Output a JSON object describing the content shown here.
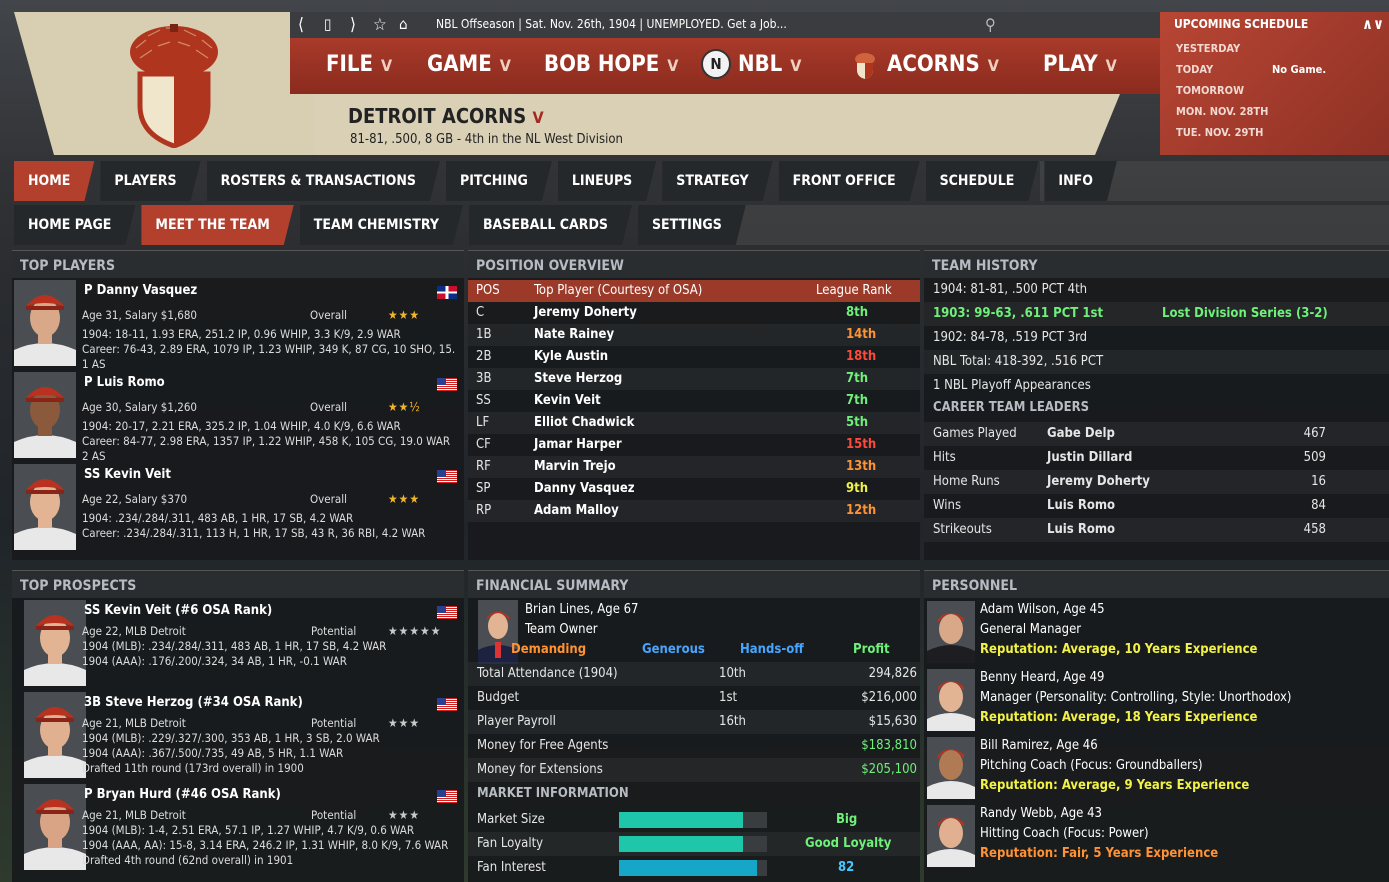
{
  "topbar": {
    "status": "NBL Offseason  |  Sat. Nov. 26th, 1904  |  UNEMPLOYED. Get a Job..."
  },
  "menu": {
    "file": "FILE",
    "game": "GAME",
    "user": "BOB HOPE",
    "league": "NBL",
    "team": "ACORNS",
    "play": "PLAY",
    "league_badge": "N"
  },
  "team": {
    "name": "DETROIT ACORNS",
    "record": "81-81, .500, 8 GB - 4th in the NL West Division"
  },
  "schedule": {
    "title": "UPCOMING SCHEDULE",
    "days": [
      "YESTERDAY",
      "TODAY",
      "TOMORROW",
      "MON. NOV. 28TH",
      "TUE. NOV. 29TH"
    ],
    "today_game": "No Game."
  },
  "nav_main": [
    "HOME",
    "PLAYERS",
    "ROSTERS & TRANSACTIONS",
    "PITCHING",
    "LINEUPS",
    "STRATEGY",
    "FRONT OFFICE",
    "SCHEDULE",
    "INFO"
  ],
  "nav_sub": [
    "HOME PAGE",
    "MEET THE TEAM",
    "TEAM CHEMISTRY",
    "BASEBALL CARDS",
    "SETTINGS"
  ],
  "top_players": {
    "title": "TOP PLAYERS",
    "overall_label": "Overall",
    "players": [
      {
        "name": "P Danny Vasquez",
        "info": "Age 31, Salary $1,680",
        "stars": "★★★",
        "line1": "1904: 18-11, 1.93 ERA, 251.2 IP, 0.96 WHIP, 3.3 K/9, 2.9 WAR",
        "line2": "Career: 76-43, 2.89 ERA, 1079 IP, 1.23 WHIP, 349 K, 87 CG, 10 SHO, 15.",
        "line3": "1 AS"
      },
      {
        "name": "P Luis Romo",
        "info": "Age 30, Salary $1,260",
        "stars": "★★½",
        "line1": "1904: 20-17, 2.21 ERA, 325.2 IP, 1.04 WHIP, 4.0 K/9, 6.6 WAR",
        "line2": "Career: 84-77, 2.98 ERA, 1357 IP, 1.22 WHIP, 458 K, 105 CG, 19.0 WAR",
        "line3": "2 AS"
      },
      {
        "name": "SS Kevin Veit",
        "info": "Age 22, Salary $370",
        "stars": "★★★",
        "line1": "1904: .234/.284/.311, 483 AB, 1 HR, 17 SB, 4.2 WAR",
        "line2": "Career: .234/.284/.311, 113 H, 1 HR, 17 SB, 43 R, 36 RBI, 4.2 WAR",
        "line3": ""
      }
    ]
  },
  "position_overview": {
    "title": "POSITION OVERVIEW",
    "headers": [
      "POS",
      "Top Player (Courtesy of OSA)",
      "League Rank"
    ],
    "rows": [
      {
        "pos": "C",
        "player": "Jeremy Doherty",
        "rank": "8th",
        "color": "#6ef07a"
      },
      {
        "pos": "1B",
        "player": "Nate Rainey",
        "rank": "14th",
        "color": "#ff9233"
      },
      {
        "pos": "2B",
        "player": "Kyle Austin",
        "rank": "18th",
        "color": "#ff4a3a"
      },
      {
        "pos": "3B",
        "player": "Steve Herzog",
        "rank": "7th",
        "color": "#6ef07a"
      },
      {
        "pos": "SS",
        "player": "Kevin Veit",
        "rank": "7th",
        "color": "#6ef07a"
      },
      {
        "pos": "LF",
        "player": "Elliot Chadwick",
        "rank": "5th",
        "color": "#6ef07a"
      },
      {
        "pos": "CF",
        "player": "Jamar Harper",
        "rank": "15th",
        "color": "#ff4a3a"
      },
      {
        "pos": "RF",
        "player": "Marvin Trejo",
        "rank": "13th",
        "color": "#ff9233"
      },
      {
        "pos": "SP",
        "player": "Danny Vasquez",
        "rank": "9th",
        "color": "#f2f246"
      },
      {
        "pos": "RP",
        "player": "Adam Malloy",
        "rank": "12th",
        "color": "#ff9233"
      }
    ]
  },
  "team_history": {
    "title": "TEAM HISTORY",
    "rows": [
      "1904: 81-81, .500 PCT 4th",
      "1903: 99-63, .611 PCT 1st",
      "1902: 84-78, .519 PCT 3rd",
      "NBL Total: 418-392, .516 PCT",
      "1 NBL Playoff Appearances"
    ],
    "note_1903": "Lost Division Series (3-2)",
    "leaders_title": "CAREER TEAM LEADERS",
    "leaders": [
      {
        "cat": "Games Played",
        "name": "Gabe Delp",
        "val": "467"
      },
      {
        "cat": "Hits",
        "name": "Justin Dillard",
        "val": "509"
      },
      {
        "cat": "Home Runs",
        "name": "Jeremy Doherty",
        "val": "16"
      },
      {
        "cat": "Wins",
        "name": "Luis Romo",
        "val": "84"
      },
      {
        "cat": "Strikeouts",
        "name": "Luis Romo",
        "val": "458"
      }
    ]
  },
  "top_prospects": {
    "title": "TOP PROSPECTS",
    "potential_label": "Potential",
    "players": [
      {
        "name": "SS Kevin Veit (#6 OSA Rank)",
        "info": "Age 22, MLB Detroit",
        "stars": "★★★★★",
        "line1": "1904 (MLB): .234/.284/.311, 483 AB, 1 HR, 17 SB, 4.2 WAR",
        "line2": "1904 (AAA): .176/.200/.324, 34 AB, 1 HR, -0.1 WAR",
        "line3": ""
      },
      {
        "name": "3B Steve Herzog (#34 OSA Rank)",
        "info": "Age 21, MLB Detroit",
        "stars": "★★★",
        "line1": "1904 (MLB): .229/.327/.300, 353 AB, 1 HR, 3 SB, 2.0 WAR",
        "line2": "1904 (AAA): .367/.500/.735, 49 AB, 5 HR, 1.1 WAR",
        "line3": "Drafted 11th round (173rd overall) in 1900"
      },
      {
        "name": "P Bryan Hurd (#46 OSA Rank)",
        "info": "Age 21, MLB Detroit",
        "stars": "★★★",
        "line1": "1904 (MLB): 1-4, 2.51 ERA, 57.1 IP, 1.27 WHIP, 4.7 K/9, 0.6 WAR",
        "line2": "1904 (AAA, AA): 15-8, 3.14 ERA, 246.2 IP, 1.31 WHIP, 8.0 K/9, 7.6 WAR",
        "line3": "Drafted 4th round (62nd overall) in 1901"
      }
    ]
  },
  "financial": {
    "title": "FINANCIAL SUMMARY",
    "owner_name": "Brian Lines, Age 67",
    "owner_role": "Team Owner",
    "traits": [
      "Demanding",
      "Generous",
      "Hands-off",
      "Profit"
    ],
    "rows": [
      {
        "label": "Total Attendance (1904)",
        "rank": "10th",
        "value": "294,826"
      },
      {
        "label": "Budget",
        "rank": "1st",
        "value": "$216,000"
      },
      {
        "label": "Player Payroll",
        "rank": "16th",
        "value": "$15,630"
      },
      {
        "label": "Money for Free Agents",
        "rank": "",
        "value": "$183,810"
      },
      {
        "label": "Money for Extensions",
        "rank": "",
        "value": "$205,100"
      }
    ],
    "market_title": "MARKET INFORMATION",
    "market": [
      {
        "label": "Market Size",
        "value": "Big",
        "fill": 0.84,
        "color": "#1fc7aa"
      },
      {
        "label": "Fan Loyalty",
        "value": "Good Loyalty",
        "fill": 0.84,
        "color": "#1fc7aa"
      },
      {
        "label": "Fan Interest",
        "value": "82",
        "fill": 0.93,
        "color": "#16a7c8"
      }
    ]
  },
  "personnel": {
    "title": "PERSONNEL",
    "people": [
      {
        "name": "Adam Wilson, Age 45",
        "role": "General Manager",
        "rep": "Reputation: Average, 10 Years Experience",
        "rep_color": "#f2f246"
      },
      {
        "name": "Benny Heard, Age 49",
        "role": "Manager (Personality: Controlling, Style: Unorthodox)",
        "rep": "Reputation: Average, 18 Years Experience",
        "rep_color": "#f2f246"
      },
      {
        "name": "Bill Ramirez, Age 46",
        "role": "Pitching Coach (Focus: Groundballers)",
        "rep": "Reputation: Average, 9 Years Experience",
        "rep_color": "#f2f246"
      },
      {
        "name": "Randy Webb, Age 43",
        "role": "Hitting Coach (Focus: Power)",
        "rep": "Reputation: Fair, 5 Years Experience",
        "rep_color": "#ff9233"
      }
    ]
  }
}
